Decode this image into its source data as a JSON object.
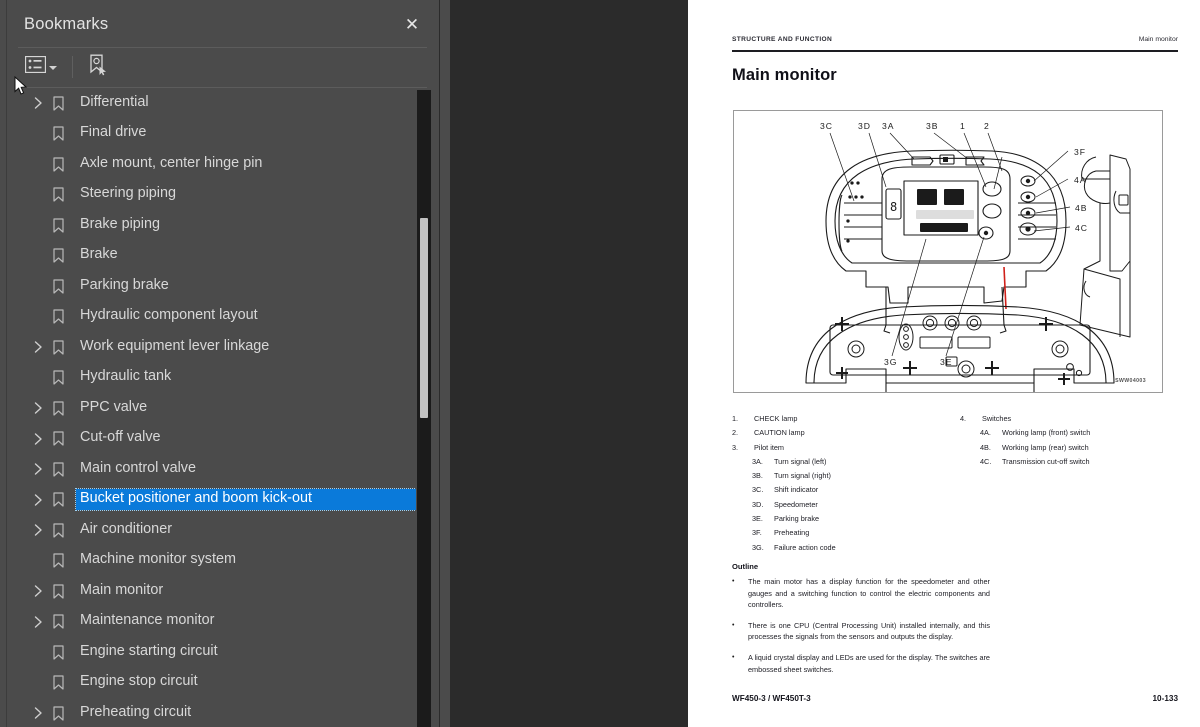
{
  "panel": {
    "title": "Bookmarks",
    "close_label": "✕",
    "toolbar": {
      "list_options_icon": "list-options-icon",
      "caret_icon": "chevron-down-icon",
      "new_bookmark_icon": "new-bookmark-icon"
    },
    "items": [
      {
        "label": "Differential",
        "expandable": true,
        "selected": false
      },
      {
        "label": "Final drive",
        "expandable": false,
        "selected": false
      },
      {
        "label": "Axle mount, center hinge pin",
        "expandable": false,
        "selected": false
      },
      {
        "label": "Steering piping",
        "expandable": false,
        "selected": false
      },
      {
        "label": "Brake piping",
        "expandable": false,
        "selected": false
      },
      {
        "label": "Brake",
        "expandable": false,
        "selected": false
      },
      {
        "label": "Parking brake",
        "expandable": false,
        "selected": false
      },
      {
        "label": "Hydraulic component layout",
        "expandable": false,
        "selected": false
      },
      {
        "label": "Work equipment lever linkage",
        "expandable": true,
        "selected": false
      },
      {
        "label": "Hydraulic tank",
        "expandable": false,
        "selected": false
      },
      {
        "label": "PPC valve",
        "expandable": true,
        "selected": false
      },
      {
        "label": "Cut-off valve",
        "expandable": true,
        "selected": false
      },
      {
        "label": "Main control valve",
        "expandable": true,
        "selected": false
      },
      {
        "label": "Bucket positioner and boom kick-out",
        "expandable": true,
        "selected": true
      },
      {
        "label": "Air conditioner",
        "expandable": true,
        "selected": false
      },
      {
        "label": "Machine monitor system",
        "expandable": false,
        "selected": false
      },
      {
        "label": "Main monitor",
        "expandable": true,
        "selected": false
      },
      {
        "label": "Maintenance monitor",
        "expandable": true,
        "selected": false
      },
      {
        "label": "Engine starting circuit",
        "expandable": false,
        "selected": false
      },
      {
        "label": "Engine stop circuit",
        "expandable": false,
        "selected": false
      },
      {
        "label": "Preheating circuit",
        "expandable": true,
        "selected": false
      }
    ],
    "colors": {
      "selection": "#0a7ada",
      "panel_bg": "#4b4b4b",
      "text": "#d8d8d8"
    }
  },
  "document": {
    "header_left": "STRUCTURE AND FUNCTION",
    "header_right": "Main monitor",
    "title": "Main monitor",
    "figure_code": "SWW04003",
    "legend_left": [
      {
        "n": "1.",
        "t": "CHECK lamp",
        "sub": false
      },
      {
        "n": "2.",
        "t": "CAUTION lamp",
        "sub": false
      },
      {
        "n": "3.",
        "t": "Pilot item",
        "sub": false
      },
      {
        "n": "3A.",
        "t": "Turn signal (left)",
        "sub": true
      },
      {
        "n": "3B.",
        "t": "Turn signal (right)",
        "sub": true
      },
      {
        "n": "3C.",
        "t": "Shift indicator",
        "sub": true
      },
      {
        "n": "3D.",
        "t": "Speedometer",
        "sub": true
      },
      {
        "n": "3E.",
        "t": "Parking brake",
        "sub": true
      },
      {
        "n": "3F.",
        "t": "Preheating",
        "sub": true
      },
      {
        "n": "3G.",
        "t": "Failure action code",
        "sub": true
      }
    ],
    "legend_right": [
      {
        "n": "4.",
        "t": "Switches",
        "sub": false
      },
      {
        "n": "4A.",
        "t": "Working lamp (front) switch",
        "sub": true
      },
      {
        "n": "4B.",
        "t": "Working lamp (rear) switch",
        "sub": true
      },
      {
        "n": "4C.",
        "t": "Transmission cut-off switch",
        "sub": true
      }
    ],
    "outline_title": "Outline",
    "outline_bullets": [
      "The main motor has a display function for the speedometer and other gauges and a switching function to control the electric components and controllers.",
      "There is one CPU (Central Processing Unit) installed internally, and this processes the signals from the sensors and outputs the display.",
      "A liquid crystal display and LEDs are used for the display. The switches are embossed sheet switches."
    ],
    "footer_left": "WF450-3 / WF450T-3",
    "footer_right": "10-133",
    "figure_callouts": [
      "3C",
      "3D",
      "3A",
      "3B",
      "1",
      "2",
      "3F",
      "4A",
      "4B",
      "4C",
      "3G",
      "3E"
    ]
  }
}
